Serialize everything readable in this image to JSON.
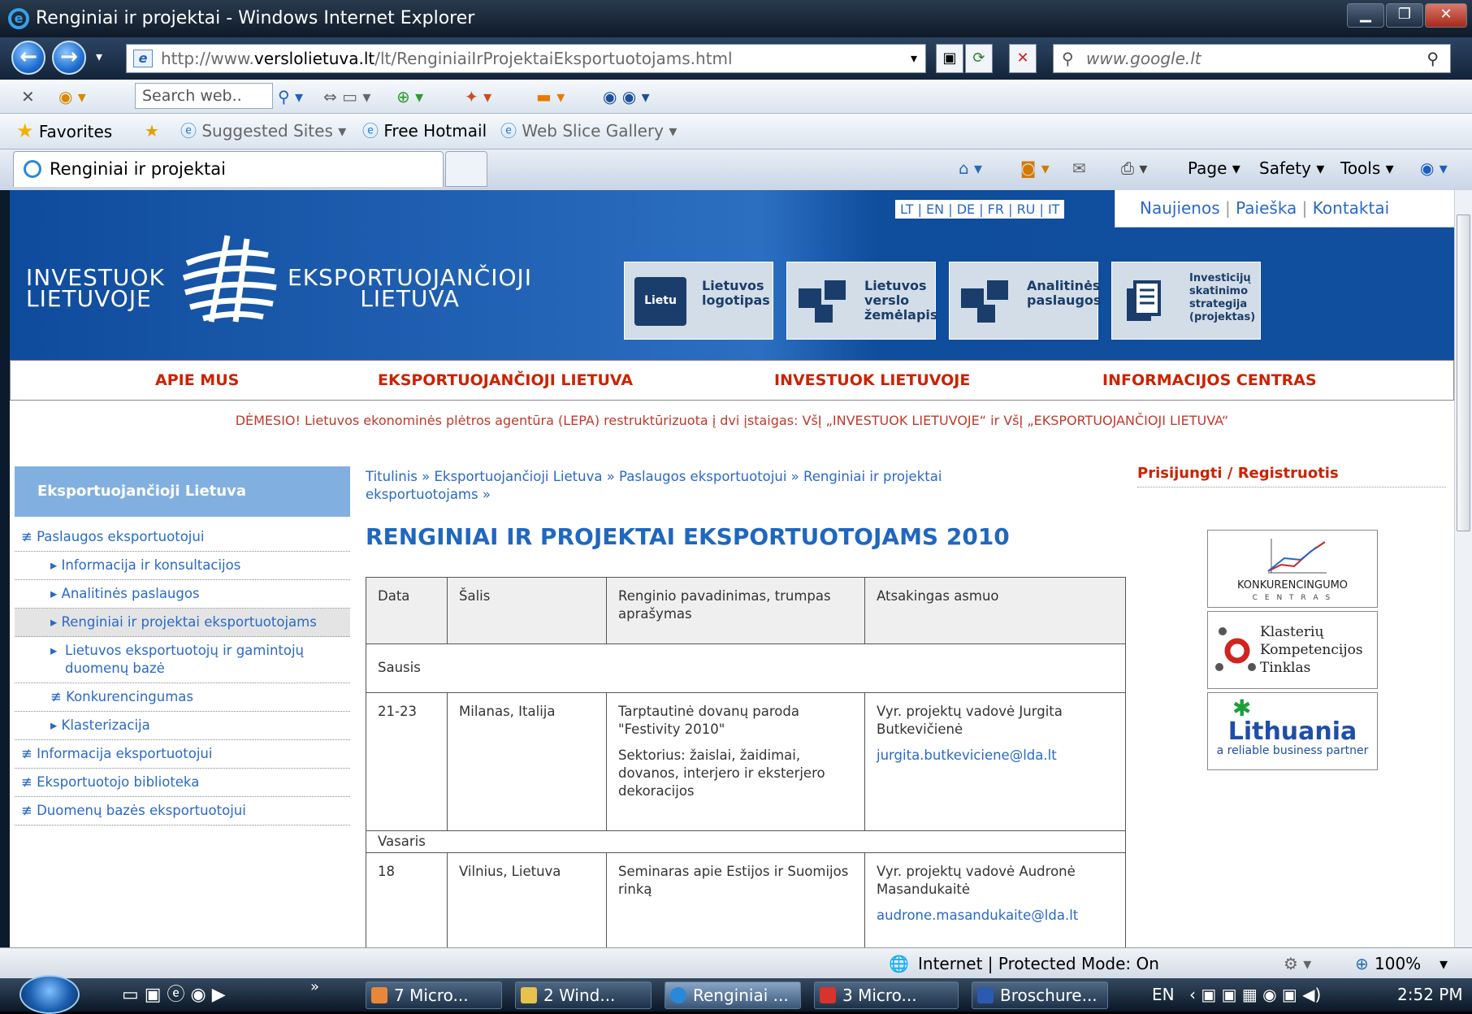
{
  "window": {
    "title": "Renginiai ir projektai - Windows Internet Explorer"
  },
  "address": {
    "prefix": "http://www.",
    "domain": "verslolietuva.lt",
    "path": "/lt/RenginiaiIrProjektaiEksportuotojams.html",
    "search_placeholder": "www.google.lt"
  },
  "toolbar": {
    "search_web": "Search web..",
    "favorites": "Favorites",
    "suggested_sites": "Suggested Sites ▾",
    "free_hotmail": "Free Hotmail",
    "web_slice_gallery": "Web Slice Gallery ▾"
  },
  "tab": {
    "label": "Renginiai ir projektai"
  },
  "commands": {
    "page": "Page ▾",
    "safety": "Safety ▾",
    "tools": "Tools ▾"
  },
  "site": {
    "logo_left": [
      "INVESTUOK",
      "LIETUVOJE"
    ],
    "logo_right": [
      "EKSPORTUOJANČIOJI",
      "LIETUVA"
    ],
    "languages": "LT | EN | DE | FR | RU | IT",
    "top_nav": [
      "Naujienos",
      "Paieška",
      "Kontaktai"
    ],
    "quick_links": [
      "Lietuvos logotipas",
      "Lietuvos verslo žemėlapis",
      "Analitinės paslaugos",
      "Investicijų skatinimo strategija (projektas)"
    ],
    "quick_link_badge": "Lietu",
    "main_nav": [
      "APIE MUS",
      "EKSPORTUOJANČIOJI LIETUVA",
      "INVESTUOK LIETUVOJE",
      "INFORMACIJOS CENTRAS"
    ],
    "notice": "DĖMESIO! Lietuvos ekonominės plėtros agentūra (LEPA) restruktūrizuota į dvi įstaigas: VšĮ „INVESTUOK LIETUVOJE“ ir VšĮ „EKSPORTUOJANČIOJI LIETUVA“"
  },
  "sidebar": {
    "header": "Eksportuojančioji Lietuva",
    "items": [
      {
        "label": "Paslaugos eksportuotojui",
        "level": 0
      },
      {
        "label": "Informacija ir konsultacijos",
        "level": 1
      },
      {
        "label": "Analitinės paslaugos",
        "level": 1
      },
      {
        "label": "Renginiai ir projektai eksportuotojams",
        "level": 1
      },
      {
        "label": "Lietuvos eksportuotojų ir gamintojų duomenų bazė",
        "level": 1
      },
      {
        "label": "Konkurencingumas",
        "level": 1
      },
      {
        "label": "Klasterizacija",
        "level": 1
      },
      {
        "label": "Informacija eksportuotojui",
        "level": 0
      },
      {
        "label": "Eksportuotojo biblioteka",
        "level": 0
      },
      {
        "label": "Duomenų bazės eksportuotojui",
        "level": 0
      }
    ]
  },
  "breadcrumb": "Titulinis  »  Eksportuojančioji Lietuva  »  Paslaugos eksportuotojui  »  Renginiai ir projektai eksportuotojams  »",
  "page_title": "RENGINIAI IR PROJEKTAI EKSPORTUOTOJAMS 2010",
  "table": {
    "headers": [
      "Data",
      "Šalis",
      "Renginio pavadinimas, trumpas aprašymas",
      "Atsakingas asmuo"
    ],
    "month1": "Sausis",
    "row1": {
      "date": "21-23",
      "country": "Milanas, Italija",
      "name": "Tarptautinė dovanų paroda \"Festivity 2010\"",
      "desc": "Sektorius: žaislai, žaidimai, dovanos, interjero ir eksterjero dekoracijos",
      "person": "Vyr. projektų vadovė Jurgita Butkevičienė",
      "email": "jurgita.butkeviciene@lda.lt"
    },
    "month2": "Vasaris",
    "row2": {
      "date": "18",
      "country": "Vilnius, Lietuva",
      "name": "Seminaras apie Estijos ir Suomijos rinką",
      "person": "Vyr. projektų vadovė Audronė Masandukaitė",
      "email": "audrone.masandukaite@lda.lt"
    }
  },
  "right": {
    "login": "Prisijungti / Registruotis",
    "logo1": "KONKURENCINGUMO",
    "logo1b": "C E N T R A S",
    "logo2": [
      "Klasterių",
      "Kompetencijos",
      "Tinklas"
    ],
    "logo3": "Lithuania",
    "logo3b": "a reliable business partner"
  },
  "status": {
    "zone": "Internet | Protected Mode: On",
    "zoom": "100%"
  },
  "taskbar": {
    "tasks": [
      "7 Micro...",
      "2 Wind...",
      "Renginiai ...",
      "3 Micro...",
      "Broschure..."
    ],
    "lang": "EN",
    "time": "2:52 PM"
  }
}
